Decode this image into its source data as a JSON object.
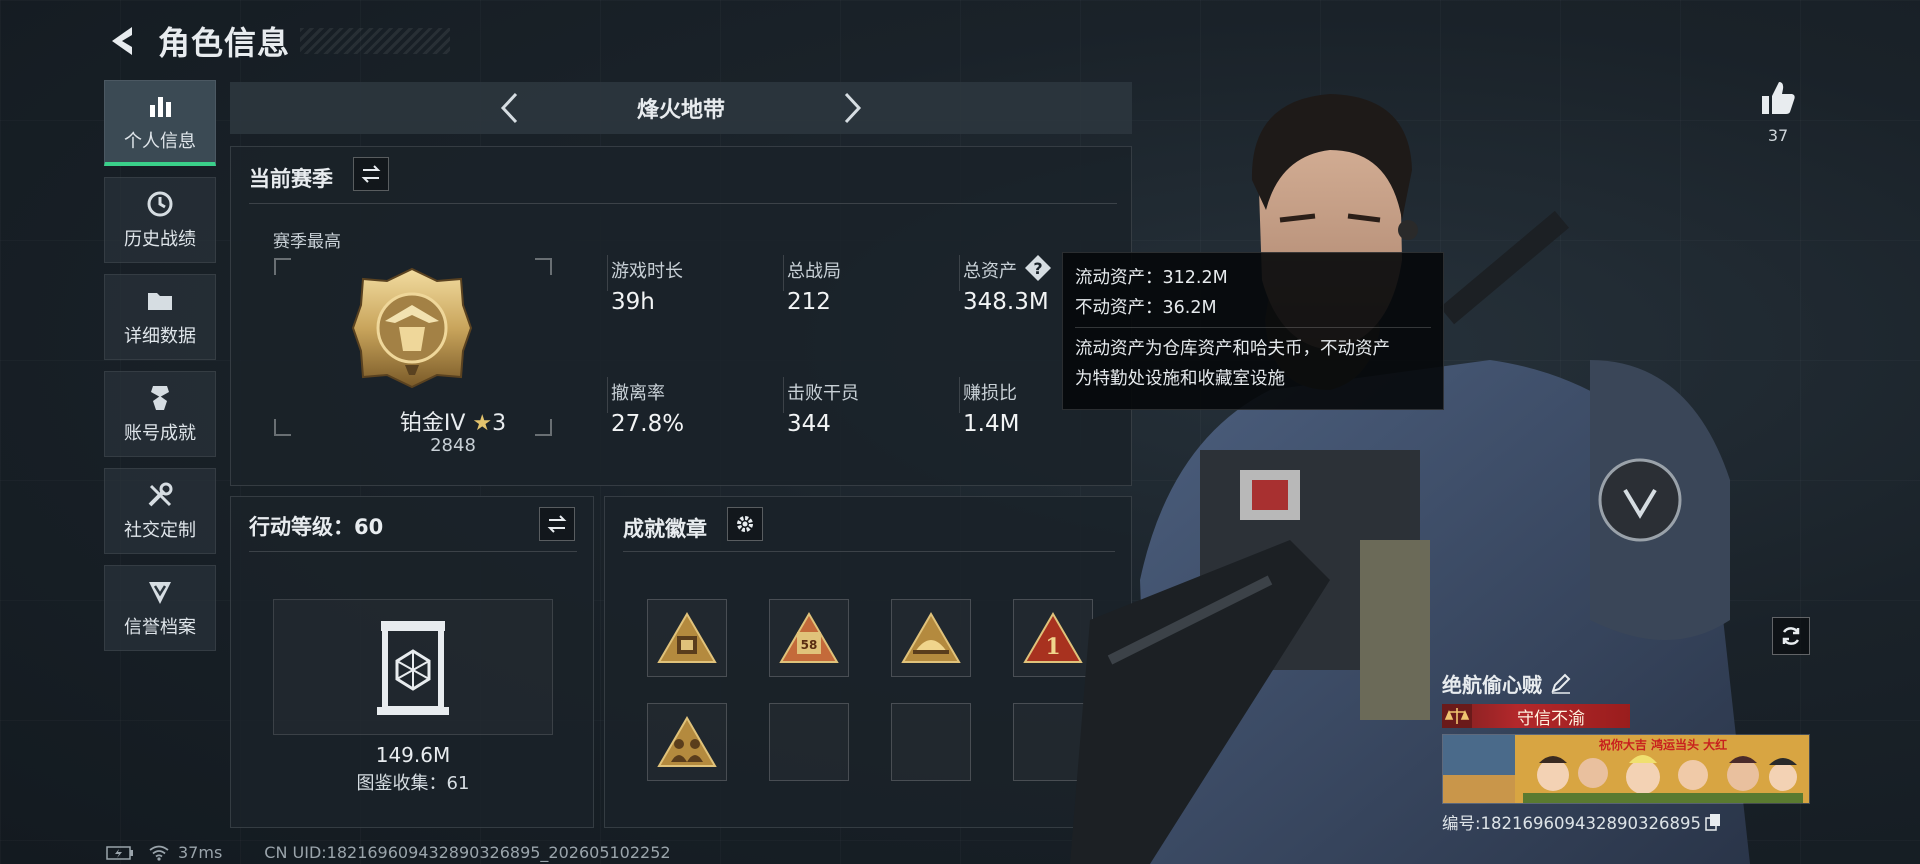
{
  "header": {
    "title": "角色信息"
  },
  "sidebar": {
    "items": [
      {
        "label": "个人信息",
        "icon": "bar-chart-icon",
        "active": true
      },
      {
        "label": "历史战绩",
        "icon": "clock-icon",
        "active": false
      },
      {
        "label": "详细数据",
        "icon": "folder-icon",
        "active": false
      },
      {
        "label": "账号成就",
        "icon": "medal-icon",
        "active": false
      },
      {
        "label": "社交定制",
        "icon": "tools-icon",
        "active": false
      },
      {
        "label": "信誉档案",
        "icon": "shield-icon",
        "active": false
      }
    ]
  },
  "mode_selector": {
    "name": "烽火地带"
  },
  "current_season": {
    "title": "当前赛季",
    "best_label": "赛季最高",
    "rank_name": "铂金IV",
    "rank_stars": "3",
    "rank_points": "2848",
    "stats": [
      {
        "label": "游戏时长",
        "value": "39h"
      },
      {
        "label": "总战局",
        "value": "212"
      },
      {
        "label": "总资产",
        "value": "348.3M"
      },
      {
        "label": "撤离率",
        "value": "27.8%"
      },
      {
        "label": "击败干员",
        "value": "344"
      },
      {
        "label": "赚损比",
        "value": "1.4M"
      }
    ]
  },
  "tooltip": {
    "line1": "流动资产：312.2M",
    "line2": "不动资产：36.2M",
    "desc1": "流动资产为仓库资产和哈夫币，不动资产",
    "desc2": "为特勤处设施和收藏室设施"
  },
  "action_level": {
    "title": "行动等级：60",
    "value": "149.6M",
    "collection": "图鉴收集：61"
  },
  "badges": {
    "title": "成就徽章",
    "slots": [
      {
        "filled": true,
        "glyph": ""
      },
      {
        "filled": true,
        "glyph": "58"
      },
      {
        "filled": true,
        "glyph": ""
      },
      {
        "filled": true,
        "glyph": "1"
      },
      {
        "filled": true,
        "glyph": ""
      },
      {
        "filled": false,
        "glyph": ""
      },
      {
        "filled": false,
        "glyph": ""
      },
      {
        "filled": false,
        "glyph": ""
      }
    ]
  },
  "likes": {
    "count": "37"
  },
  "profile": {
    "nickname": "绝航偷心贼",
    "title_banner": "守信不渝",
    "card_banner_text": "祝你大吉 鸿运当头 大红",
    "uid_label": "编号:1821696094328903268​95"
  },
  "status": {
    "ping": "37ms",
    "uid": "CN UID:18216960943289032689​5_202605102252"
  },
  "colors": {
    "accent": "#3ad08a",
    "gold": "#c9a55c",
    "banner_red": "#b3282b"
  }
}
